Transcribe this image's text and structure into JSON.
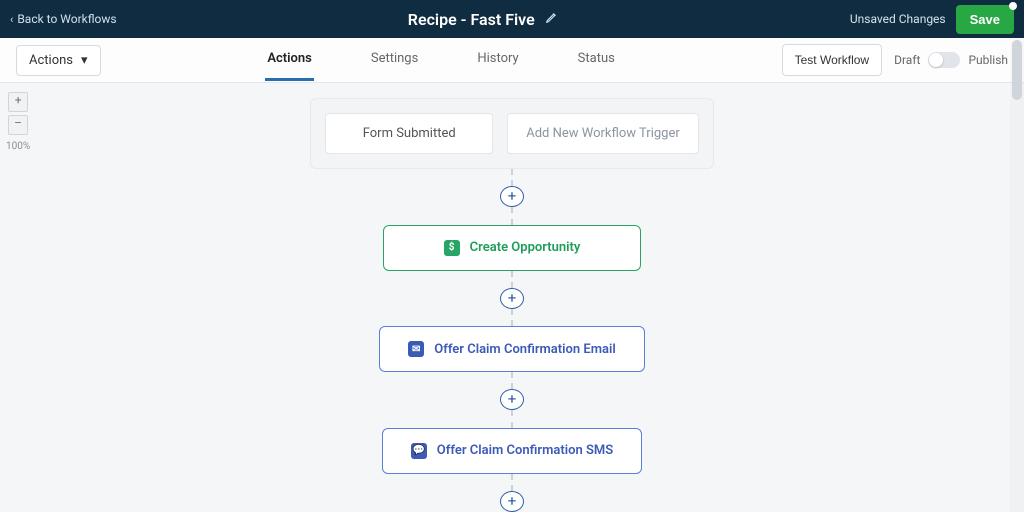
{
  "header": {
    "back_label": "Back to Workflows",
    "title": "Recipe - Fast Five",
    "unsaved_label": "Unsaved Changes",
    "save_label": "Save"
  },
  "toolbar": {
    "actions_dd": "Actions",
    "tabs": [
      "Actions",
      "Settings",
      "History",
      "Status"
    ],
    "active_tab_index": 0,
    "test_label": "Test Workflow",
    "draft_label": "Draft",
    "publish_label": "Publish"
  },
  "zoom": {
    "plus": "+",
    "minus": "–",
    "level": "100%"
  },
  "triggers": {
    "existing": "Form Submitted",
    "add_label": "Add New Workflow Trigger"
  },
  "nodes": [
    {
      "style": "green",
      "icon": "$",
      "label": "Create Opportunity"
    },
    {
      "style": "blue",
      "icon": "✉",
      "label": "Offer Claim Confirmation Email"
    },
    {
      "style": "blue",
      "icon": "💬",
      "label": "Offer Claim Confirmation SMS"
    }
  ]
}
